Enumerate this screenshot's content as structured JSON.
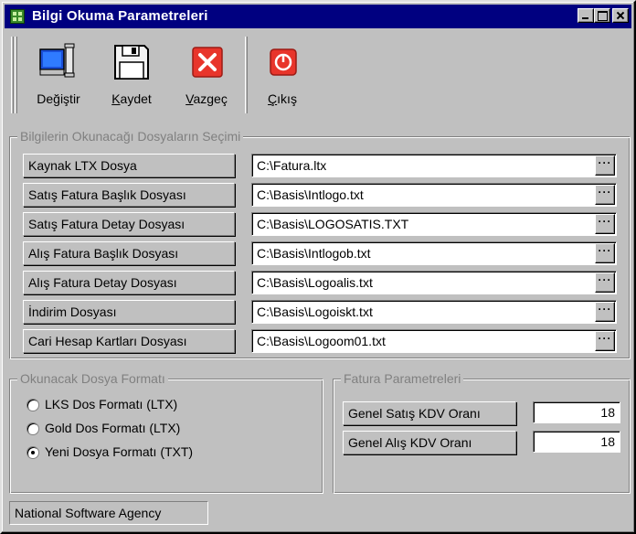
{
  "window": {
    "title": "Bilgi Okuma Parametreleri",
    "controls": [
      "minimize",
      "maximize",
      "close"
    ]
  },
  "toolbar": {
    "items": [
      {
        "label": "Değiştir",
        "icon": "monitor-edit-icon"
      },
      {
        "label": "Kaydet",
        "icon": "floppy-disk-icon"
      },
      {
        "label": "Vazgeç",
        "icon": "red-x-icon"
      },
      {
        "label": "Çıkış",
        "icon": "power-exit-icon"
      }
    ]
  },
  "files_group": {
    "title": "Bilgilerin Okunacağı Dosyaların Seçimi",
    "rows": [
      {
        "label": "Kaynak LTX Dosya",
        "value": "C:\\Fatura.ltx"
      },
      {
        "label": "Satış Fatura Başlık Dosyası",
        "value": "C:\\Basis\\Intlogo.txt"
      },
      {
        "label": "Satış Fatura Detay Dosyası",
        "value": "C:\\Basis\\LOGOSATIS.TXT"
      },
      {
        "label": "Alış Fatura Başlık Dosyası",
        "value": "C:\\Basis\\Intlogob.txt"
      },
      {
        "label": "Alış Fatura Detay Dosyası",
        "value": "C:\\Basis\\Logoalis.txt"
      },
      {
        "label": "İndirim Dosyası",
        "value": "C:\\Basis\\Logoiskt.txt"
      },
      {
        "label": "Cari Hesap Kartları Dosyası",
        "value": "C:\\Basis\\Logoom01.txt"
      }
    ],
    "browse_label": "···"
  },
  "format_group": {
    "title": "Okunacak Dosya Formatı",
    "options": [
      {
        "label": "LKS Dos Formatı  (LTX)",
        "selected": false
      },
      {
        "label": "Gold Dos Formatı (LTX)",
        "selected": false
      },
      {
        "label": "Yeni Dosya Formatı (TXT)",
        "selected": true
      }
    ]
  },
  "invoice_group": {
    "title": "Fatura Parametreleri",
    "rows": [
      {
        "label": "Genel Satış KDV Oranı",
        "value": "18"
      },
      {
        "label": "Genel Alış KDV Oranı",
        "value": "18"
      }
    ]
  },
  "statusbar": {
    "text": "National Software Agency"
  },
  "colors": {
    "titlebar": "#000080",
    "face": "#c0c0c0",
    "red": "#e8352b"
  }
}
